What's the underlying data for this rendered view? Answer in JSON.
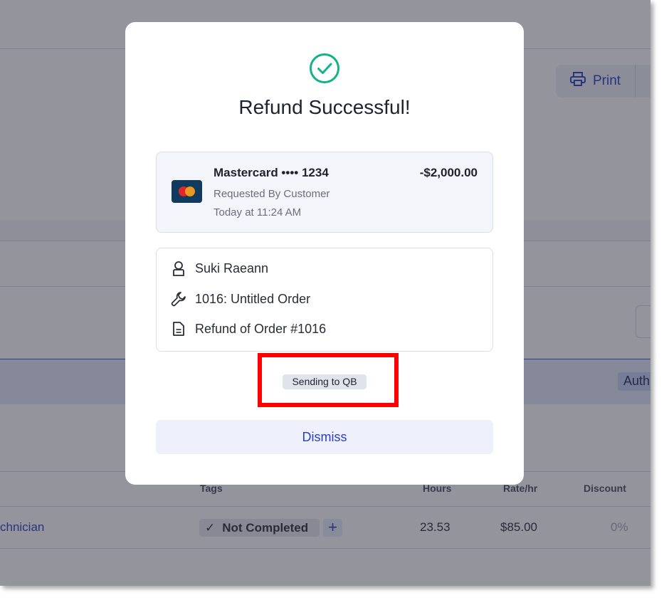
{
  "background": {
    "print_label": "Print",
    "side_badge": "Auth",
    "table": {
      "headers": {
        "tags": "Tags",
        "hours": "Hours",
        "rate": "Rate/hr",
        "discount": "Discount"
      },
      "row": {
        "role": "chnician",
        "tag": "Not Completed",
        "tag_add": "+",
        "hours": "23.53",
        "rate": "$85.00",
        "discount": "0%"
      }
    }
  },
  "modal": {
    "icon": "check-circle-icon",
    "title": "Refund Successful!",
    "payment": {
      "card_label": "Mastercard •••• 1234",
      "amount": "-$2,000.00",
      "reason": "Requested By Customer",
      "time": "Today at 11:24 AM",
      "card_icon": "mastercard-logo"
    },
    "details": [
      {
        "icon": "user-icon",
        "text": "Suki Raeann"
      },
      {
        "icon": "wrench-icon",
        "text": "1016: Untitled Order"
      },
      {
        "icon": "document-icon",
        "text": "Refund of Order #1016"
      }
    ],
    "sync_status": "Sending to QB",
    "dismiss_label": "Dismiss"
  },
  "colors": {
    "accent": "#2a3fc4",
    "success": "#12b38a",
    "highlight": "#ff0000"
  }
}
